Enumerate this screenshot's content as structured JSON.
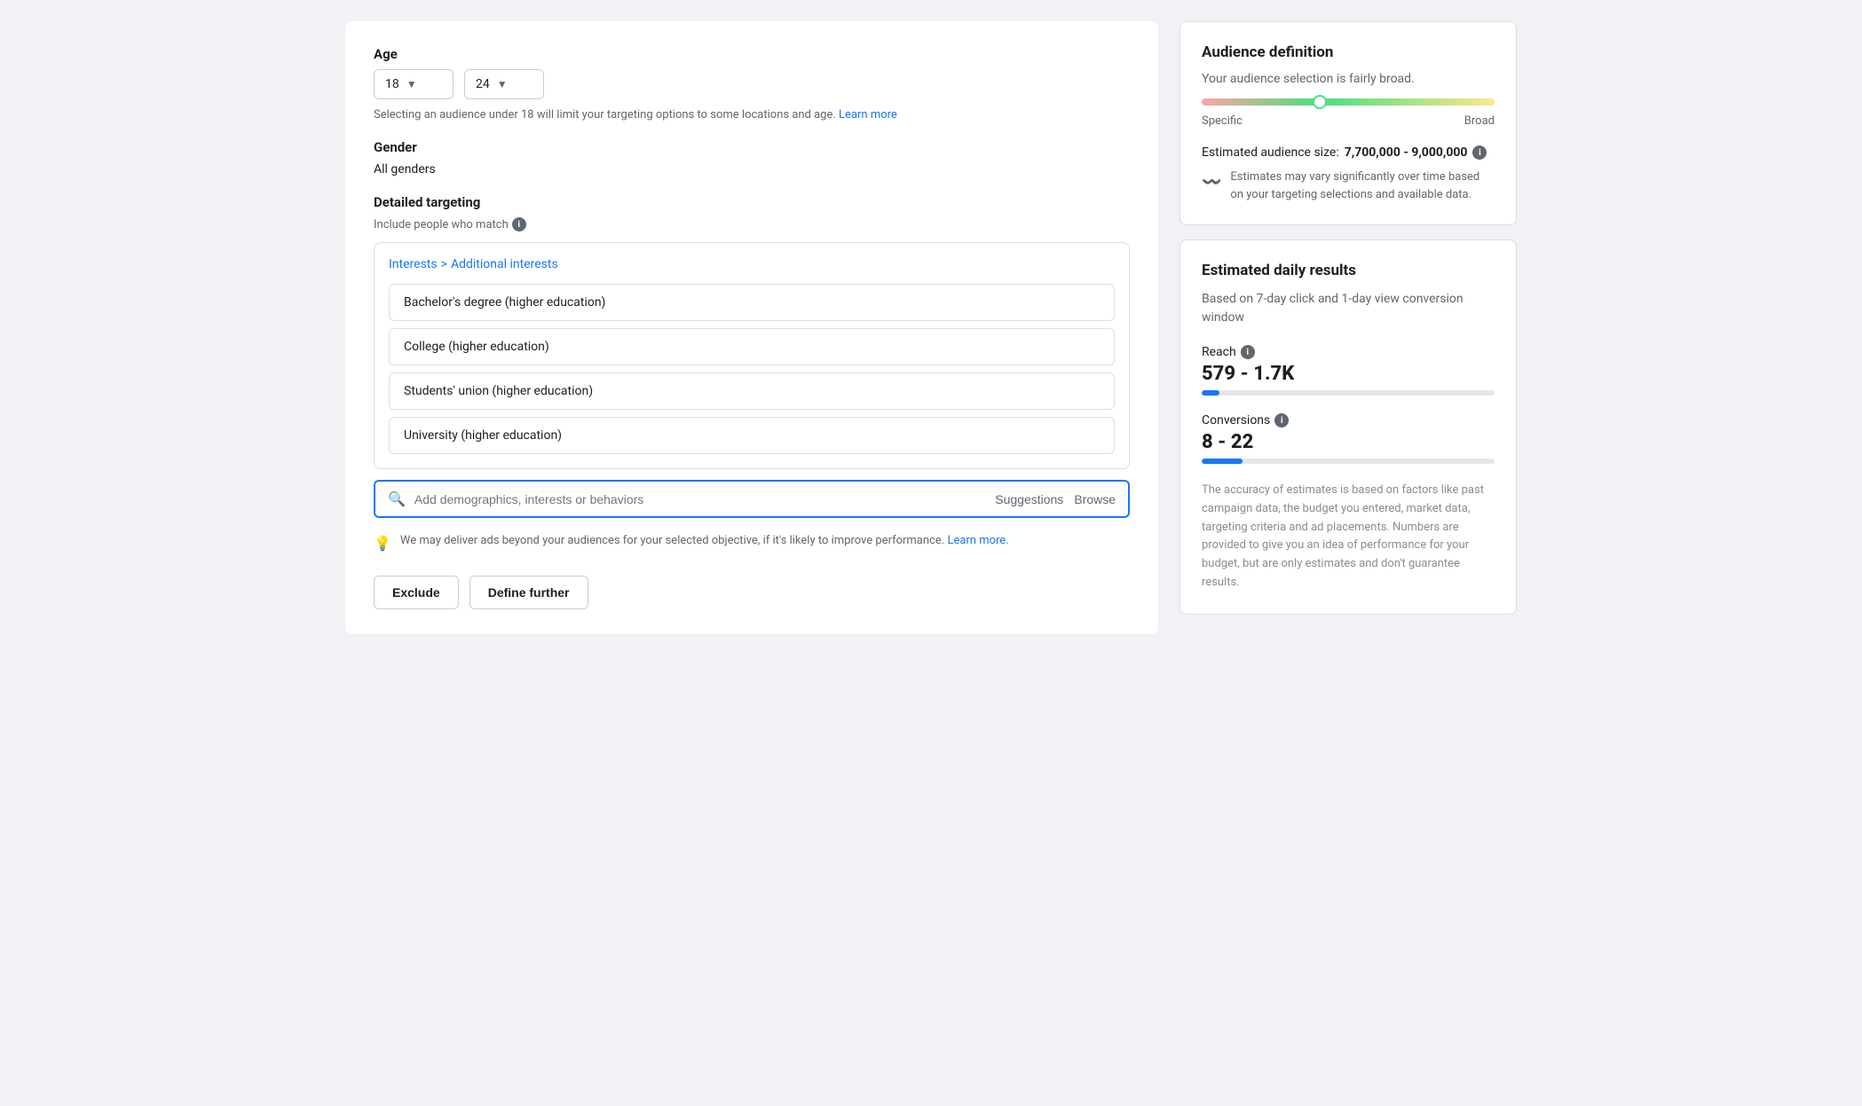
{
  "age": {
    "label": "Age",
    "from": "18",
    "to": "24",
    "note": "Selecting an audience under 18 will limit your targeting options to some locations and age.",
    "learn_more": "Learn more"
  },
  "gender": {
    "label": "Gender",
    "value": "All genders"
  },
  "detailed_targeting": {
    "label": "Detailed targeting",
    "include_label": "Include people who match",
    "breadcrumb": {
      "interests": "Interests",
      "separator": ">",
      "additional": "Additional interests"
    },
    "items": [
      {
        "text": "Bachelor's degree (higher education)"
      },
      {
        "text": "College (higher education)"
      },
      {
        "text": "Students' union (higher education)"
      },
      {
        "text": "University (higher education)"
      }
    ],
    "search_placeholder": "Add demographics, interests or behaviors",
    "suggestions_label": "Suggestions",
    "browse_label": "Browse",
    "hint_text": "We may deliver ads beyond your audiences for your selected objective, if it's likely to improve performance.",
    "hint_learn_more": "Learn more.",
    "exclude_btn": "Exclude",
    "define_further_btn": "Define further"
  },
  "audience_definition": {
    "title": "Audience definition",
    "description": "Your audience selection is fairly broad.",
    "meter_specific": "Specific",
    "meter_broad": "Broad",
    "size_label": "Estimated audience size:",
    "size_value": "7,700,000 - 9,000,000",
    "estimates_note": "Estimates may vary significantly over time based on your targeting selections and available data."
  },
  "estimated_daily": {
    "title": "Estimated daily results",
    "description": "Based on 7-day click and 1-day view conversion window",
    "reach_label": "Reach",
    "reach_value": "579 - 1.7K",
    "reach_bar_pct": 6,
    "conversions_label": "Conversions",
    "conversions_value": "8 - 22",
    "conversions_bar_pct": 14,
    "accuracy_note": "The accuracy of estimates is based on factors like past campaign data, the budget you entered, market data, targeting criteria and ad placements. Numbers are provided to give you an idea of performance for your budget, but are only estimates and don't guarantee results."
  }
}
